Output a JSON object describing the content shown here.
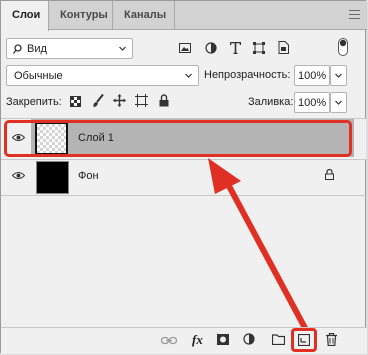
{
  "tabs": [
    {
      "label": "Слои",
      "active": true
    },
    {
      "label": "Контуры",
      "active": false
    },
    {
      "label": "Каналы",
      "active": false
    }
  ],
  "filter": {
    "kind_label": "Вид",
    "icons": [
      "image-filter-icon",
      "adjustment-filter-icon",
      "type-filter-icon",
      "shape-filter-icon",
      "smart-object-filter-icon",
      "filter-toggle-icon"
    ]
  },
  "blend": {
    "mode": "Обычные",
    "opacity_label": "Непрозрачность:",
    "opacity_value": "100%"
  },
  "lock": {
    "label": "Закрепить:",
    "fill_label": "Заливка:",
    "fill_value": "100%"
  },
  "layers": [
    {
      "name": "Слой 1",
      "thumbnail": "transparent",
      "selected": true,
      "visible": true,
      "locked": false
    },
    {
      "name": "Фон",
      "thumbnail": "black",
      "selected": false,
      "visible": true,
      "locked": true
    }
  ],
  "bottom": {
    "fx_label": "fx",
    "icons": [
      "link-icon",
      "fx-icon",
      "mask-icon",
      "adjustment-icon",
      "folder-icon",
      "new-layer-icon",
      "trash-icon"
    ]
  },
  "colors": {
    "highlight": "#e03024",
    "selected_row": "#b4b4b4",
    "panel": "#f0f0f0"
  }
}
